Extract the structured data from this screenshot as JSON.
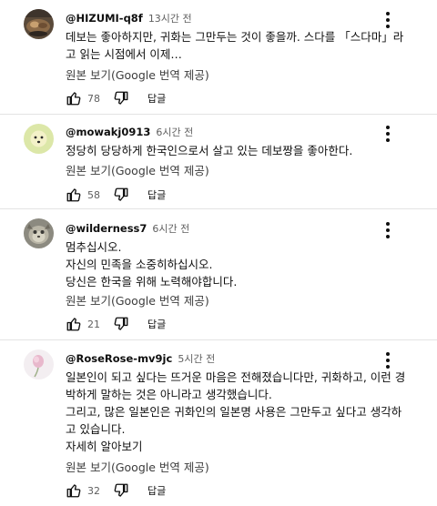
{
  "comments": [
    {
      "author": "@HIZUMI-q8f",
      "time": "13시간 전",
      "lines": [
        "데보는 좋아하지만, 귀화는 그만두는 것이 좋을까. 스다를 「스다마」라",
        "고 읽는 시점에서 이제…"
      ],
      "translate_label": "원본 보기(Google 번역 제공)",
      "likes": "78",
      "reply_label": "답글",
      "avatar_icon": "food-photo-avatar"
    },
    {
      "author": "@mowakj0913",
      "time": "6시간 전",
      "lines": [
        "정당히 당당하게 한국인으로서 살고 있는 데보짱을 좋아한다."
      ],
      "translate_label": "원본 보기(Google 번역 제공)",
      "likes": "58",
      "reply_label": "답글",
      "avatar_icon": "smiley-face-avatar"
    },
    {
      "author": "@wilderness7",
      "time": "6시간 전",
      "lines": [
        "멈추십시오.",
        "자신의 민족을 소중히하십시오.",
        "당신은 한국을 위해 노력해야합니다."
      ],
      "translate_label": "원본 보기(Google 번역 제공)",
      "likes": "21",
      "reply_label": "답글",
      "avatar_icon": "animal-photo-avatar"
    },
    {
      "author": "@RoseRose-mv9jc",
      "time": "5시간 전",
      "lines": [
        "일본인이 되고 싶다는 뜨거운 마음은 전해졌습니다만, 귀화하고, 이런 경",
        "박하게 말하는 것은 아니라고 생각했습니다.",
        "그리고, 많은 일본인은 귀화인의 일본명 사용은 그만두고 싶다고 생각하",
        "고 있습니다."
      ],
      "more_label": "자세히 알아보기",
      "translate_label": "원본 보기(Google 번역 제공)",
      "likes": "32",
      "reply_label": "답글",
      "avatar_icon": "rose-photo-avatar"
    }
  ],
  "colors": {
    "text": "#0f0f0f",
    "meta": "#606060",
    "divider": "#e3e3e3",
    "smiley_avatar_bg": "#dce7a8"
  }
}
